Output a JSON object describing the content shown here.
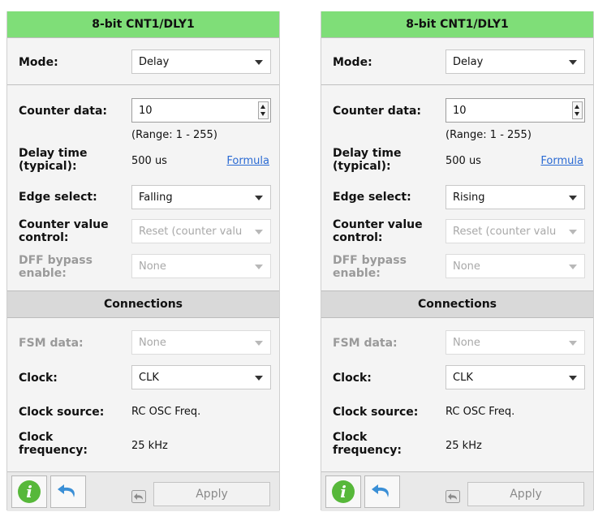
{
  "panels": [
    {
      "title": "8-bit CNT1/DLY1",
      "mode_label": "Mode:",
      "mode_value": "Delay",
      "counter_data_label": "Counter data:",
      "counter_data_value": "10",
      "range_text": "(Range:  1 - 255)",
      "delay_time_label_1": "Delay time",
      "delay_time_label_2": "(typical):",
      "delay_time_value": "500 us",
      "formula_link": "Formula",
      "edge_select_label": "Edge select:",
      "edge_select_value": "Falling",
      "counter_value_label_1": "Counter value",
      "counter_value_label_2": "control:",
      "counter_value_value": "Reset (counter valu",
      "dff_label_1": "DFF bypass",
      "dff_label_2": "enable:",
      "dff_value": "None",
      "connections_title": "Connections",
      "fsm_label": "FSM data:",
      "fsm_value": "None",
      "clock_label": "Clock:",
      "clock_value": "CLK",
      "clock_source_label": "Clock source:",
      "clock_source_value": "RC OSC Freq.",
      "clock_freq_label_1": "Clock",
      "clock_freq_label_2": "frequency:",
      "clock_freq_value": "25 kHz",
      "info_icon_glyph": "i",
      "apply_label": "Apply"
    },
    {
      "title": "8-bit CNT1/DLY1",
      "mode_label": "Mode:",
      "mode_value": "Delay",
      "counter_data_label": "Counter data:",
      "counter_data_value": "10",
      "range_text": "(Range:  1 - 255)",
      "delay_time_label_1": "Delay time",
      "delay_time_label_2": "(typical):",
      "delay_time_value": "500 us",
      "formula_link": "Formula",
      "edge_select_label": "Edge select:",
      "edge_select_value": "Rising",
      "counter_value_label_1": "Counter value",
      "counter_value_label_2": "control:",
      "counter_value_value": "Reset (counter valu",
      "dff_label_1": "DFF bypass",
      "dff_label_2": "enable:",
      "dff_value": "None",
      "connections_title": "Connections",
      "fsm_label": "FSM data:",
      "fsm_value": "None",
      "clock_label": "Clock:",
      "clock_value": "CLK",
      "clock_source_label": "Clock source:",
      "clock_source_value": "RC OSC Freq.",
      "clock_freq_label_1": "Clock",
      "clock_freq_label_2": "frequency:",
      "clock_freq_value": "25 kHz",
      "info_icon_glyph": "i",
      "apply_label": "Apply"
    }
  ],
  "colors": {
    "title_bar": "#7fde78",
    "section_bar": "#d9d9d9",
    "link": "#2a6ad3",
    "info_icon": "#57b83a",
    "undo_icon": "#3a8fd6"
  }
}
